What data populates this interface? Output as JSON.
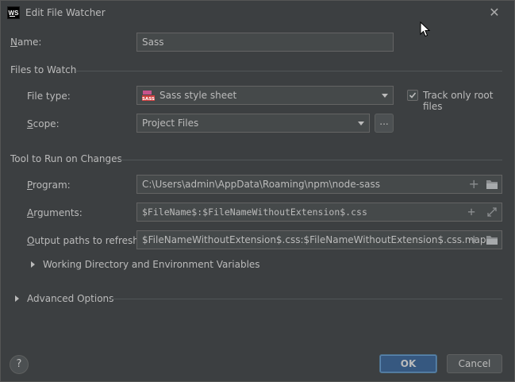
{
  "window": {
    "title": "Edit File Watcher",
    "app_logo_text": "WS"
  },
  "name": {
    "label_first": "N",
    "label_rest": "ame:",
    "value": "Sass"
  },
  "files_to_watch": {
    "section_title": "Files to Watch",
    "file_type_label": "File type:",
    "file_type_value": "Sass style sheet",
    "file_type_icon_text": "SASS",
    "track_root_label": "Track only root files",
    "track_root_checked": true,
    "scope_label_first": "S",
    "scope_label_rest": "cope:",
    "scope_value": "Project Files",
    "scope_more_button": "..."
  },
  "tool": {
    "section_title": "Tool to Run on Changes",
    "program_label_first": "P",
    "program_label_rest": "rogram:",
    "program_value": "C:\\Users\\admin\\AppData\\Roaming\\npm\\node-sass",
    "arguments_label_first": "A",
    "arguments_label_rest": "rguments:",
    "arguments_value": "$FileName$:$FileNameWithoutExtension$.css",
    "output_label_first": "O",
    "output_label_rest": "utput paths to refresh:",
    "output_value": "$FileNameWithoutExtension$.css:$FileNameWithoutExtension$.css.map",
    "working_dir_label": "Working Directory and Environment Variables"
  },
  "advanced": {
    "label": "Advanced Options"
  },
  "footer": {
    "help_label": "?",
    "ok_label": "OK",
    "cancel_label": "Cancel"
  },
  "icons": {
    "close": "close-icon",
    "plus": "plus-icon",
    "folder": "folder-icon",
    "expand": "expand-icon",
    "chevron": "chevron-down-icon",
    "sass": "sass-file-icon"
  },
  "colors": {
    "background": "#3c3f41",
    "field_bg": "#45494a",
    "ok_button": "#365880",
    "sass_icon": "#c6538c"
  }
}
